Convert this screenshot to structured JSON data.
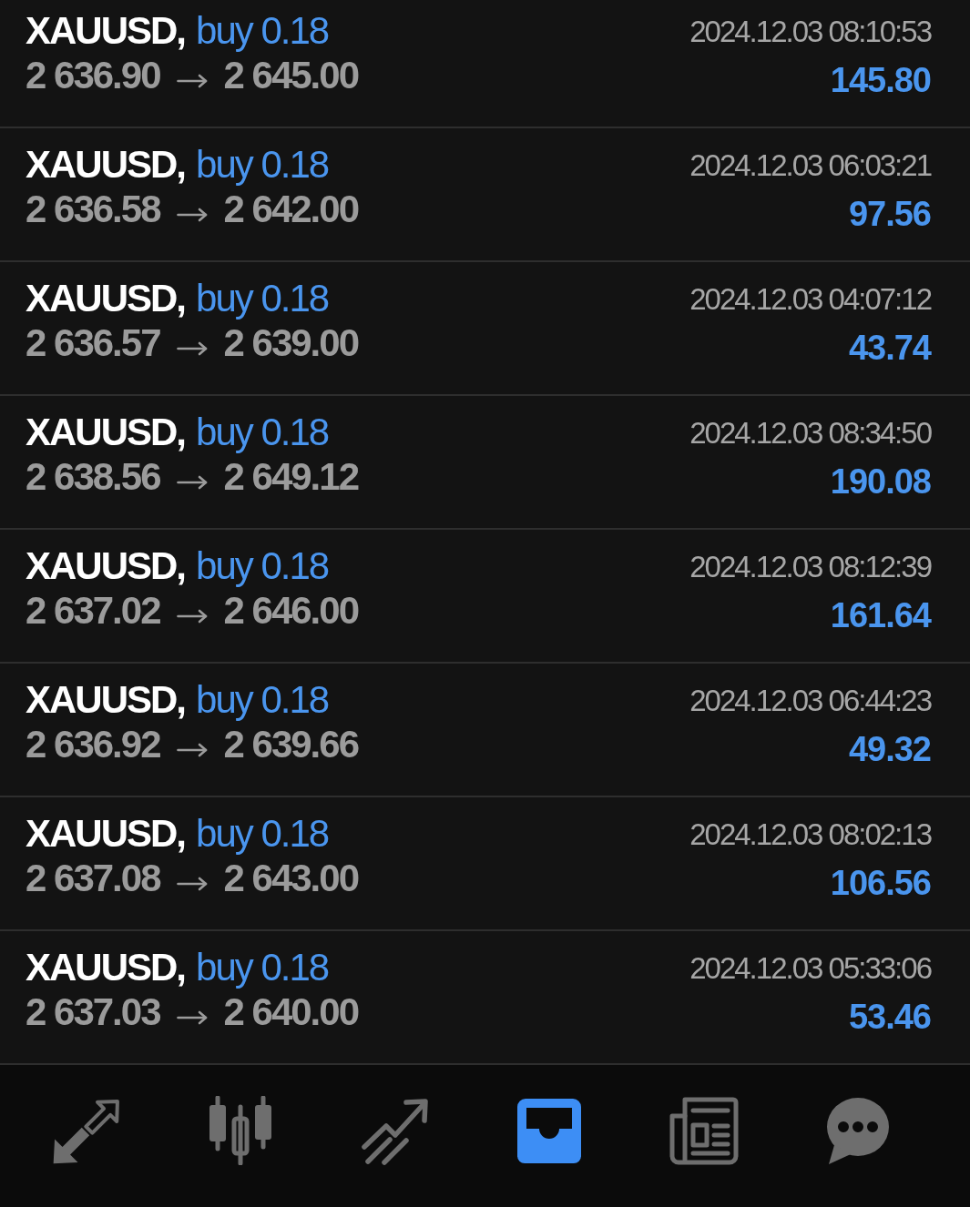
{
  "deals": [
    {
      "symbol": "XAUUSD,",
      "order": "buy 0.18",
      "open_price": "2 636.90",
      "close_price": "2 645.00",
      "time": "2024.12.03 08:10:53",
      "profit": "145.80"
    },
    {
      "symbol": "XAUUSD,",
      "order": "buy 0.18",
      "open_price": "2 636.58",
      "close_price": "2 642.00",
      "time": "2024.12.03 06:03:21",
      "profit": "97.56"
    },
    {
      "symbol": "XAUUSD,",
      "order": "buy 0.18",
      "open_price": "2 636.57",
      "close_price": "2 639.00",
      "time": "2024.12.03 04:07:12",
      "profit": "43.74"
    },
    {
      "symbol": "XAUUSD,",
      "order": "buy 0.18",
      "open_price": "2 638.56",
      "close_price": "2 649.12",
      "time": "2024.12.03 08:34:50",
      "profit": "190.08"
    },
    {
      "symbol": "XAUUSD,",
      "order": "buy 0.18",
      "open_price": "2 637.02",
      "close_price": "2 646.00",
      "time": "2024.12.03 08:12:39",
      "profit": "161.64"
    },
    {
      "symbol": "XAUUSD,",
      "order": "buy 0.18",
      "open_price": "2 636.92",
      "close_price": "2 639.66",
      "time": "2024.12.03 06:44:23",
      "profit": "49.32"
    },
    {
      "symbol": "XAUUSD,",
      "order": "buy 0.18",
      "open_price": "2 637.08",
      "close_price": "2 643.00",
      "time": "2024.12.03 08:02:13",
      "profit": "106.56"
    },
    {
      "symbol": "XAUUSD,",
      "order": "buy 0.18",
      "open_price": "2 637.03",
      "close_price": "2 640.00",
      "time": "2024.12.03 05:33:06",
      "profit": "53.46"
    }
  ],
  "nav_items": [
    {
      "selected": false
    },
    {
      "selected": false
    },
    {
      "selected": false
    },
    {
      "selected": true
    },
    {
      "selected": false
    },
    {
      "selected": false
    }
  ]
}
